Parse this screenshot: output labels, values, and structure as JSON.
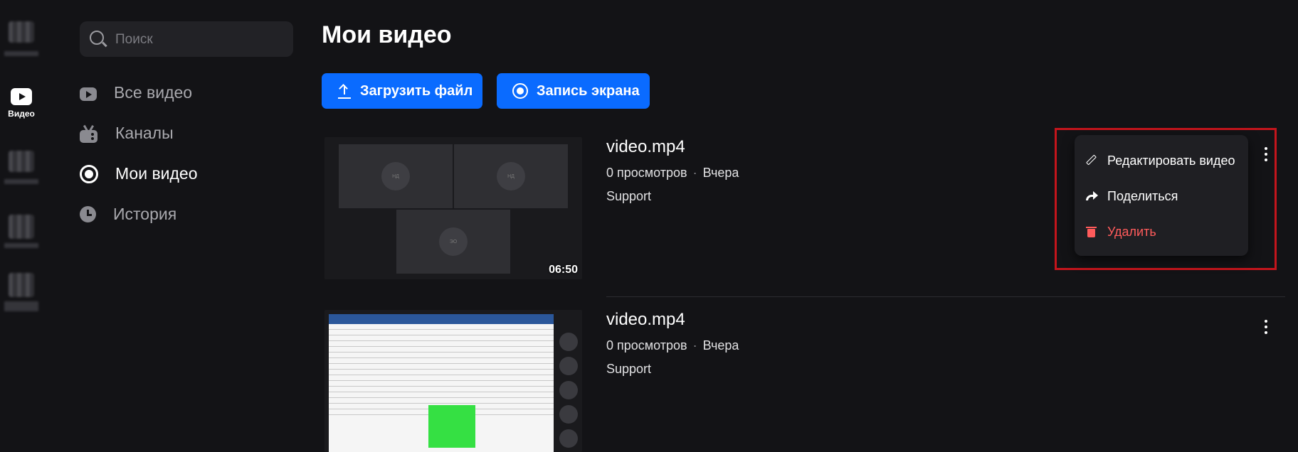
{
  "rail": {
    "video_label": "Видео"
  },
  "search": {
    "placeholder": "Поиск"
  },
  "nav": {
    "items": [
      {
        "label": "Все видео",
        "icon": "play-icon"
      },
      {
        "label": "Каналы",
        "icon": "tv-icon"
      },
      {
        "label": "Мои видео",
        "icon": "record-icon",
        "active": true
      },
      {
        "label": "История",
        "icon": "clock-icon"
      }
    ]
  },
  "page": {
    "title": "Мои видео"
  },
  "toolbar": {
    "upload_label": "Загрузить файл",
    "record_label": "Запись экрана"
  },
  "videos": [
    {
      "name": "video.mp4",
      "views": "0 просмотров",
      "date": "Вчера",
      "channel": "Support",
      "duration": "06:50",
      "tiles": [
        "НД",
        "НД",
        "ЭО"
      ]
    },
    {
      "name": "video.mp4",
      "views": "0 просмотров",
      "date": "Вчера",
      "channel": "Support"
    }
  ],
  "context_menu": {
    "edit_label": "Редактировать видео",
    "share_label": "Поделиться",
    "delete_label": "Удалить"
  },
  "colors": {
    "accent": "#0a6bff",
    "danger": "#ff5b5b",
    "highlight": "#c4151c",
    "background": "#131316"
  }
}
